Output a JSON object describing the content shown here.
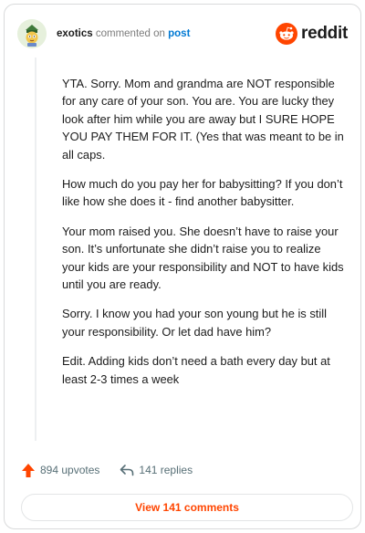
{
  "comment": {
    "username": "exotics",
    "action_text": "commented on",
    "post_link": "post",
    "paragraphs": [
      "YTA. Sorry. Mom and grandma are NOT responsible for any care of your son. You are. You are lucky they look after him while you are away but I SURE HOPE YOU PAY THEM FOR IT. (Yes that was meant to be in all caps.",
      "How much do you pay her for babysitting? If you don’t like how she does it - find another babysitter.",
      "Your mom raised you. She doesn’t have to raise your son. It’s unfortunate she didn’t raise you to realize your kids are your responsibility and NOT to have kids until you are ready.",
      "Sorry. I know you had your son young but he is still your responsibility. Or let dad have him?",
      "Edit. Adding kids don’t need a bath every day but at least 2-3 times a week"
    ]
  },
  "brand": {
    "name": "reddit",
    "icon": "reddit-logo-icon",
    "color": "#ff4500"
  },
  "stats": {
    "upvotes": "894 upvotes",
    "replies": "141 replies",
    "upvote_icon": "upvote-arrow-icon",
    "reply_icon": "reply-arrow-icon",
    "upvote_color": "#ff4500"
  },
  "view_button": "View 141 comments"
}
